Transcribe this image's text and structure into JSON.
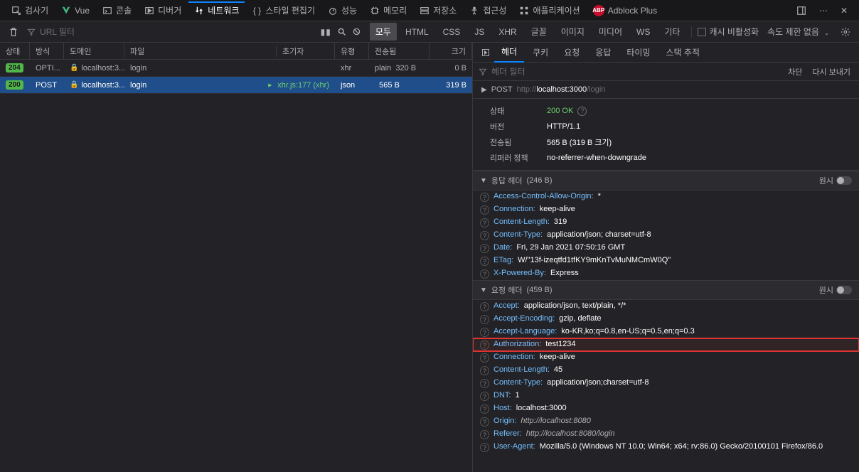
{
  "tools": {
    "inspector": "검사기",
    "vue": "Vue",
    "console": "콘솔",
    "debugger": "디버거",
    "network": "네트워크",
    "style": "스타일 편집기",
    "performance": "성능",
    "memory": "메모리",
    "storage": "저장소",
    "accessibility": "접근성",
    "application": "애플리케이션",
    "adblock": "Adblock Plus"
  },
  "filter": {
    "url_placeholder": "URL 필터",
    "all": "모두",
    "html": "HTML",
    "css": "CSS",
    "js": "JS",
    "xhr": "XHR",
    "font": "글꼴",
    "image": "이미지",
    "media": "미디어",
    "ws": "WS",
    "other": "기타",
    "disable_cache": "캐시 비활성화",
    "no_throttle": "속도 제한 없음"
  },
  "table": {
    "headers": {
      "status": "상태",
      "method": "방식",
      "domain": "도메인",
      "file": "파일",
      "initiator": "초기자",
      "type": "유형",
      "transferred": "전송됨",
      "size": "크기"
    },
    "rows": [
      {
        "status": "204",
        "method": "OPTI...",
        "domain": "localhost:3...",
        "file": "login",
        "initiator": "",
        "type": "xhr",
        "transferred": "plain",
        "size_t": "320 B",
        "size": "0 B"
      },
      {
        "status": "200",
        "method": "POST",
        "domain": "localhost:3...",
        "file": "login",
        "initiator": "xhr.js:177 (xhr)",
        "type": "json",
        "transferred": "",
        "size_t": "565 B",
        "size": "319 B"
      }
    ]
  },
  "detail": {
    "tabs": {
      "headers": "헤더",
      "cookies": "쿠키",
      "request": "요청",
      "response": "응답",
      "timing": "타이밍",
      "stack": "스택 추적"
    },
    "header_filter": "헤더 필터",
    "block": "차단",
    "resend": "다시 보내기",
    "raw": "원시",
    "method": "POST",
    "url_host": "localhost:3000",
    "url_path": "/login",
    "summary": {
      "status_label": "상태",
      "status_code": "200",
      "status_text": "OK",
      "version_label": "버전",
      "version": "HTTP/1.1",
      "transferred_label": "전송됨",
      "transferred": "565 B (319 B 크기)",
      "referrer_label": "리퍼러 정책",
      "referrer": "no-referrer-when-downgrade"
    },
    "response_headers_title": "응답 헤더",
    "response_headers_size": "(246 B)",
    "response_headers": [
      {
        "name": "Access-Control-Allow-Origin",
        "value": "*"
      },
      {
        "name": "Connection",
        "value": "keep-alive"
      },
      {
        "name": "Content-Length",
        "value": "319"
      },
      {
        "name": "Content-Type",
        "value": "application/json; charset=utf-8"
      },
      {
        "name": "Date",
        "value": "Fri, 29 Jan 2021 07:50:16 GMT"
      },
      {
        "name": "ETag",
        "value": "W/\"13f-izeqtfd1tfKY9mKnTvMuNMCmW0Q\""
      },
      {
        "name": "X-Powered-By",
        "value": "Express"
      }
    ],
    "request_headers_title": "요청 헤더",
    "request_headers_size": "(459 B)",
    "request_headers": [
      {
        "name": "Accept",
        "value": "application/json, text/plain, */*"
      },
      {
        "name": "Accept-Encoding",
        "value": "gzip, deflate"
      },
      {
        "name": "Accept-Language",
        "value": "ko-KR,ko;q=0.8,en-US;q=0.5,en;q=0.3"
      },
      {
        "name": "Authorization",
        "value": "test1234",
        "highlight": true
      },
      {
        "name": "Connection",
        "value": "keep-alive"
      },
      {
        "name": "Content-Length",
        "value": "45"
      },
      {
        "name": "Content-Type",
        "value": "application/json;charset=utf-8"
      },
      {
        "name": "DNT",
        "value": "1"
      },
      {
        "name": "Host",
        "value": "localhost:3000"
      },
      {
        "name": "Origin",
        "value": "http://localhost:8080",
        "italic": true
      },
      {
        "name": "Referer",
        "value": "http://localhost:8080/login",
        "italic": true
      },
      {
        "name": "User-Agent",
        "value": "Mozilla/5.0 (Windows NT 10.0; Win64; x64; rv:86.0) Gecko/20100101 Firefox/86.0"
      }
    ]
  }
}
